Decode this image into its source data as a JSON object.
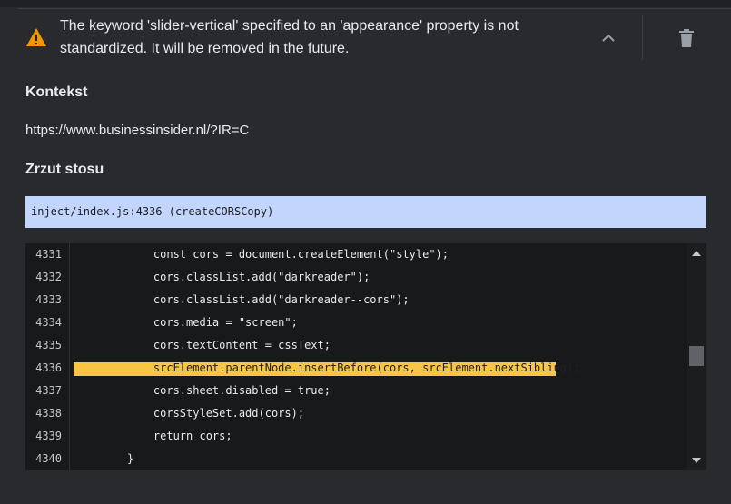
{
  "warning": {
    "icon": "warning-triangle-icon",
    "icon_color": "#f29900",
    "message": "The keyword 'slider-vertical' specified to an 'appearance' property is not standardized. It will be removed in the future."
  },
  "actions": {
    "collapse_icon": "chevron-up-icon",
    "delete_icon": "trash-icon"
  },
  "context": {
    "heading": "Kontekst",
    "url": "https://www.businessinsider.nl/?IR=C"
  },
  "stack": {
    "heading": "Zrzut stosu",
    "frame": "inject/index.js:4336 (createCORSCopy)",
    "frame_bg": "#c2d5fc"
  },
  "code": {
    "highlight_color": "#f7c744",
    "lines": [
      {
        "no": "4331",
        "text": "    const cors = document.createElement(\"style\");",
        "highlighted": false
      },
      {
        "no": "4332",
        "text": "    cors.classList.add(\"darkreader\");",
        "highlighted": false
      },
      {
        "no": "4333",
        "text": "    cors.classList.add(\"darkreader--cors\");",
        "highlighted": false
      },
      {
        "no": "4334",
        "text": "    cors.media = \"screen\";",
        "highlighted": false
      },
      {
        "no": "4335",
        "text": "    cors.textContent = cssText;",
        "highlighted": false
      },
      {
        "no": "4336",
        "text": "    srcElement.parentNode.insertBefore(cors, srcElement.nextSibling);",
        "highlighted": true
      },
      {
        "no": "4337",
        "text": "    cors.sheet.disabled = true;",
        "highlighted": false
      },
      {
        "no": "4338",
        "text": "    corsStyleSet.add(cors);",
        "highlighted": false
      },
      {
        "no": "4339",
        "text": "    return cors;",
        "highlighted": false
      },
      {
        "no": "4340",
        "text": "}",
        "highlighted": false
      }
    ]
  }
}
